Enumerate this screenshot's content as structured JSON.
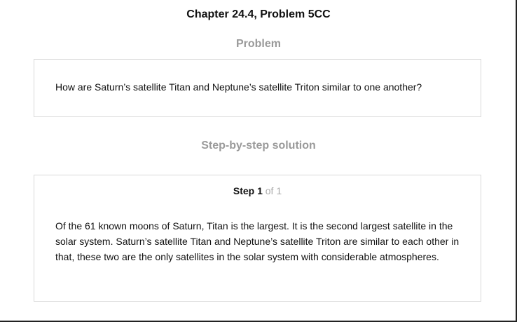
{
  "header": {
    "chapter_title": "Chapter 24.4, Problem 5CC"
  },
  "problem": {
    "heading": "Problem",
    "text": "How are Saturn’s satellite Titan and Neptune’s satellite Triton similar to one another?"
  },
  "solution": {
    "heading": "Step-by-step solution",
    "step_label": "Step 1",
    "step_of": "of 1",
    "body": "Of the 61 known moons of Saturn, Titan is the largest. It is the second largest satellite in the solar system. Saturn’s satellite Titan and Neptune’s satellite Triton are similar to each other in that, these two are the only satellites in the solar system with considerable atmospheres."
  }
}
